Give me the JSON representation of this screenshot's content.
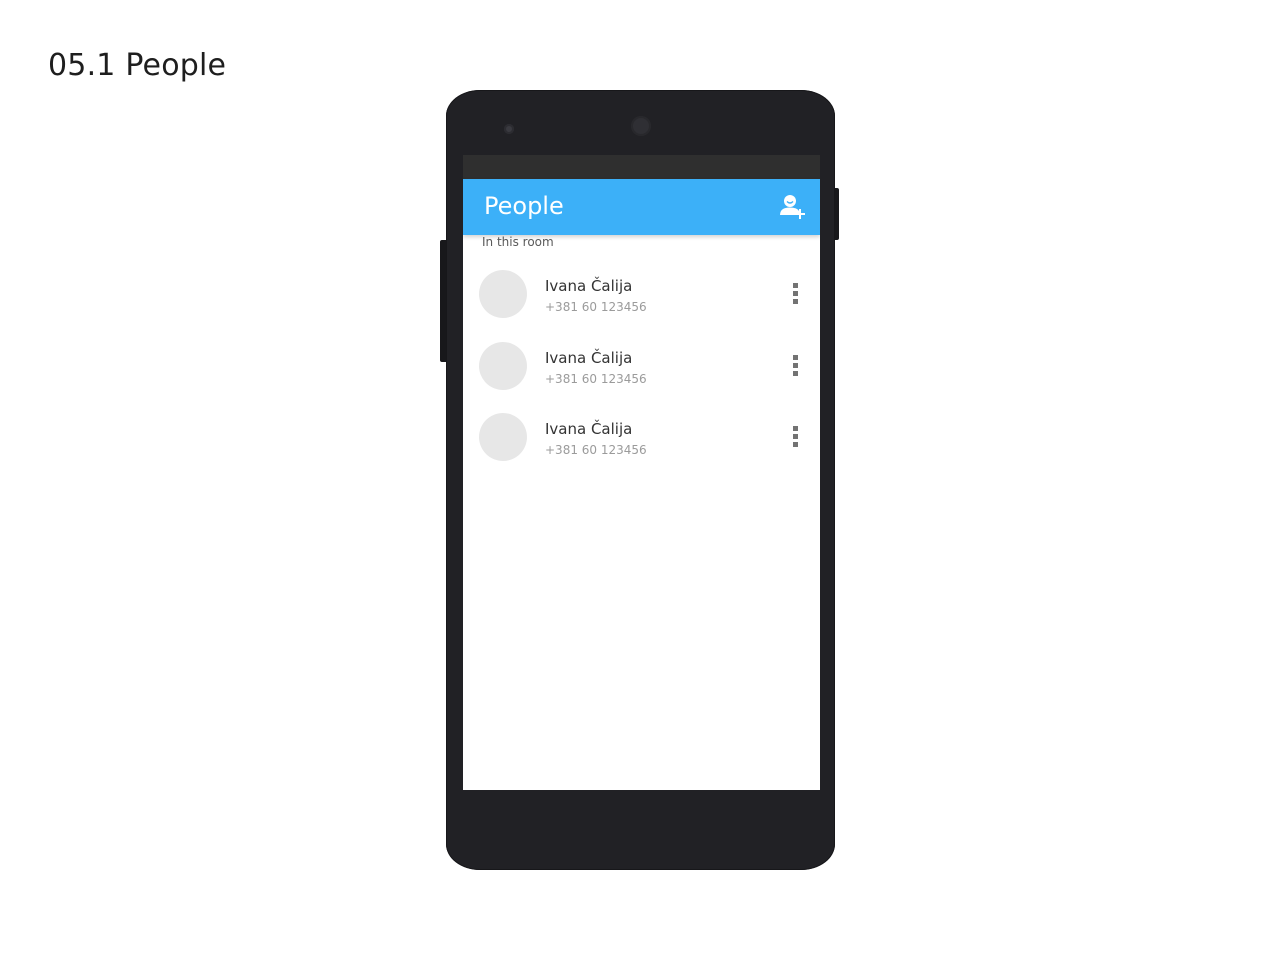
{
  "frame": {
    "title": "05.1 People"
  },
  "app_bar": {
    "title": "People",
    "action_icon": "add-person-icon",
    "color": "#3cb0f8"
  },
  "section": {
    "label": "In this room"
  },
  "people": [
    {
      "name": "Ivana Čalija",
      "phone": "+381 60 123456",
      "menu_icon": "more-vert-icon"
    },
    {
      "name": "Ivana Čalija",
      "phone": "+381 60 123456",
      "menu_icon": "more-vert-icon"
    },
    {
      "name": "Ivana Čalija",
      "phone": "+381 60 123456",
      "menu_icon": "more-vert-icon"
    }
  ]
}
